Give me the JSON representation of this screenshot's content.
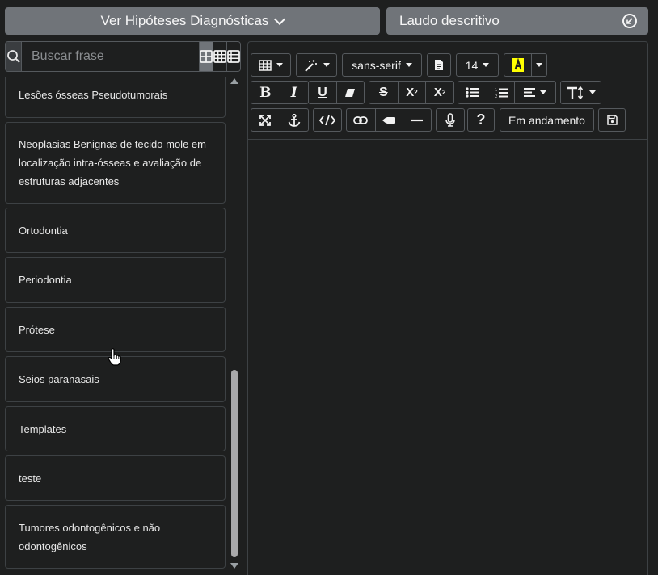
{
  "header": {
    "hypotheses_label": "Ver Hipóteses Diagnósticas",
    "report_label": "Laudo descritivo"
  },
  "search": {
    "placeholder": "Buscar frase"
  },
  "phrase_list": [
    "Lesões ósseas Pseudotumorais",
    "Neoplasias Benignas de tecido mole em localização intra-ósseas e avaliação de estruturas adjacentes",
    "Ortodontia",
    "Periodontia",
    "Prótese",
    "Seios paranasais",
    "Templates",
    "teste",
    "Tumores odontogênicos e não odontogênicos"
  ],
  "editor": {
    "font_family": "sans-serif",
    "font_size": "14",
    "status_label": "Em andamento"
  },
  "colors": {
    "button_bg": "#707479",
    "panel_bg": "#1e1f1f",
    "border": "#3d4144",
    "highlight_yellow": "#ffff00"
  }
}
